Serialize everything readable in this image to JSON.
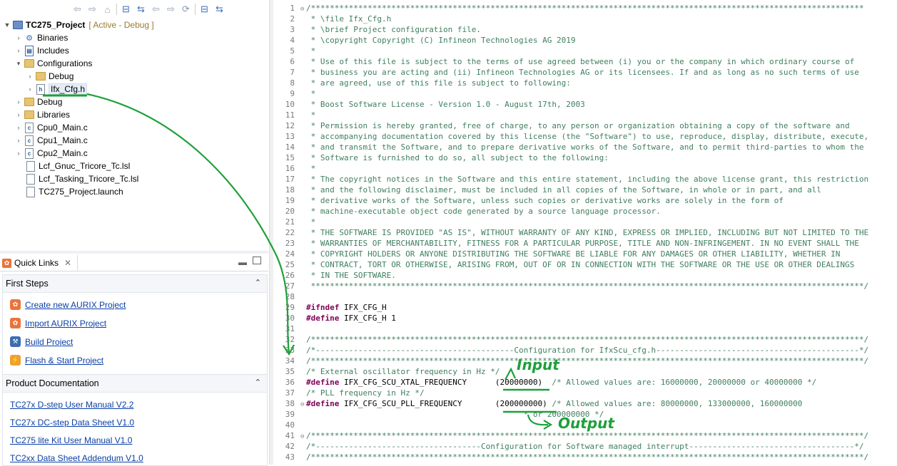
{
  "explorer": {
    "toolbar_icons": [
      "back-icon",
      "forward-icon",
      "home-icon",
      "collapse-all-icon",
      "link-editor-icon",
      "nav-back-icon",
      "nav-forward-icon",
      "sync-icon",
      "collapse-icon",
      "link-icon"
    ],
    "project_name": "TC275_Project",
    "project_status": "[ Active - Debug ]",
    "items": [
      {
        "label": "Binaries",
        "type": "binaries",
        "level": 1,
        "expanded": false
      },
      {
        "label": "Includes",
        "type": "includes",
        "level": 1,
        "expanded": false
      },
      {
        "label": "Configurations",
        "type": "folder",
        "level": 1,
        "expanded": true
      },
      {
        "label": "Debug",
        "type": "folder",
        "level": 2,
        "expanded": false
      },
      {
        "label": "Ifx_Cfg.h",
        "type": "header",
        "level": 2,
        "expanded": false,
        "selected": true
      },
      {
        "label": "Debug",
        "type": "folder",
        "level": 1,
        "expanded": false
      },
      {
        "label": "Libraries",
        "type": "folder",
        "level": 1,
        "expanded": false
      },
      {
        "label": "Cpu0_Main.c",
        "type": "c-file",
        "level": 1,
        "expanded": false
      },
      {
        "label": "Cpu1_Main.c",
        "type": "c-file",
        "level": 1,
        "expanded": false
      },
      {
        "label": "Cpu2_Main.c",
        "type": "c-file",
        "level": 1,
        "expanded": false
      },
      {
        "label": "Lcf_Gnuc_Tricore_Tc.lsl",
        "type": "file",
        "level": 1,
        "leaf": true
      },
      {
        "label": "Lcf_Tasking_Tricore_Tc.lsl",
        "type": "file",
        "level": 1,
        "leaf": true
      },
      {
        "label": "TC275_Project.launch",
        "type": "file",
        "level": 1,
        "leaf": true
      }
    ]
  },
  "quick_links": {
    "tab_title": "Quick Links",
    "first_steps_title": "First Steps",
    "first_steps": [
      {
        "label": "Create new AURIX Project",
        "color": "#e9743b",
        "icon": "new-project-icon"
      },
      {
        "label": "Import AURIX Project",
        "color": "#e9743b",
        "icon": "import-project-icon"
      },
      {
        "label": "Build Project",
        "color": "#3a6db3",
        "icon": "hammer-icon"
      },
      {
        "label": "Flash & Start Project",
        "color": "#f0a030",
        "icon": "flash-icon"
      }
    ],
    "product_doc_title": "Product Documentation",
    "docs": [
      "TC27x D-step User Manual V2.2",
      "TC27x DC-step Data Sheet V1.0",
      "TC275 lite Kit User Manual V1.0",
      "TC2xx Data Sheet Addendum V1.0"
    ]
  },
  "editor": {
    "lines": [
      {
        "n": "1",
        "t": "/*********************************************************************************************************************",
        "k": "comment",
        "fold": "-"
      },
      {
        "n": "2",
        "t": " * \\file Ifx_Cfg.h",
        "k": "comment"
      },
      {
        "n": "3",
        "t": " * \\brief Project configuration file.",
        "k": "comment"
      },
      {
        "n": "4",
        "t": " * \\copyright Copyright (C) Infineon Technologies AG 2019",
        "k": "comment"
      },
      {
        "n": "5",
        "t": " *",
        "k": "comment"
      },
      {
        "n": "6",
        "t": " * Use of this file is subject to the terms of use agreed between (i) you or the company in which ordinary course of",
        "k": "comment"
      },
      {
        "n": "7",
        "t": " * business you are acting and (ii) Infineon Technologies AG or its licensees. If and as long as no such terms of use",
        "k": "comment"
      },
      {
        "n": "8",
        "t": " * are agreed, use of this file is subject to following:",
        "k": "comment"
      },
      {
        "n": "9",
        "t": " *",
        "k": "comment"
      },
      {
        "n": "10",
        "t": " * Boost Software License - Version 1.0 - August 17th, 2003",
        "k": "comment"
      },
      {
        "n": "11",
        "t": " *",
        "k": "comment"
      },
      {
        "n": "12",
        "t": " * Permission is hereby granted, free of charge, to any person or organization obtaining a copy of the software and",
        "k": "comment"
      },
      {
        "n": "13",
        "t": " * accompanying documentation covered by this license (the \"Software\") to use, reproduce, display, distribute, execute,",
        "k": "comment"
      },
      {
        "n": "14",
        "t": " * and transmit the Software, and to prepare derivative works of the Software, and to permit third-parties to whom the",
        "k": "comment"
      },
      {
        "n": "15",
        "t": " * Software is furnished to do so, all subject to the following:",
        "k": "comment"
      },
      {
        "n": "16",
        "t": " *",
        "k": "comment"
      },
      {
        "n": "17",
        "t": " * The copyright notices in the Software and this entire statement, including the above license grant, this restriction",
        "k": "comment"
      },
      {
        "n": "18",
        "t": " * and the following disclaimer, must be included in all copies of the Software, in whole or in part, and all",
        "k": "comment"
      },
      {
        "n": "19",
        "t": " * derivative works of the Software, unless such copies or derivative works are solely in the form of",
        "k": "comment"
      },
      {
        "n": "20",
        "t": " * machine-executable object code generated by a source language processor.",
        "k": "comment"
      },
      {
        "n": "21",
        "t": " *",
        "k": "comment"
      },
      {
        "n": "22",
        "t": " * THE SOFTWARE IS PROVIDED \"AS IS\", WITHOUT WARRANTY OF ANY KIND, EXPRESS OR IMPLIED, INCLUDING BUT NOT LIMITED TO THE",
        "k": "comment"
      },
      {
        "n": "23",
        "t": " * WARRANTIES OF MERCHANTABILITY, FITNESS FOR A PARTICULAR PURPOSE, TITLE AND NON-INFRINGEMENT. IN NO EVENT SHALL THE",
        "k": "comment"
      },
      {
        "n": "24",
        "t": " * COPYRIGHT HOLDERS OR ANYONE DISTRIBUTING THE SOFTWARE BE LIABLE FOR ANY DAMAGES OR OTHER LIABILITY, WHETHER IN",
        "k": "comment"
      },
      {
        "n": "25",
        "t": " * CONTRACT, TORT OR OTHERWISE, ARISING FROM, OUT OF OR IN CONNECTION WITH THE SOFTWARE OR THE USE OR OTHER DEALINGS",
        "k": "comment"
      },
      {
        "n": "26",
        "t": " * IN THE SOFTWARE.",
        "k": "comment"
      },
      {
        "n": "27",
        "t": " *********************************************************************************************************************/",
        "k": "comment"
      },
      {
        "n": "28",
        "t": "",
        "k": "comment"
      },
      {
        "n": "29",
        "t": "#ifndef IFX_CFG_H",
        "k": "pp"
      },
      {
        "n": "30",
        "t": "#define IFX_CFG_H 1",
        "k": "pp"
      },
      {
        "n": "31",
        "t": "",
        "k": "comment"
      },
      {
        "n": "32",
        "t": "/*********************************************************************************************************************/",
        "k": "comment"
      },
      {
        "n": "33",
        "t": "/*------------------------------------------Configuration for IfxScu_cfg.h-------------------------------------------*/",
        "k": "comment"
      },
      {
        "n": "34",
        "t": "/*********************************************************************************************************************/",
        "k": "comment"
      },
      {
        "n": "35",
        "t": "/* External oscillator frequency in Hz */",
        "k": "comment"
      },
      {
        "n": "36",
        "t": "#define IFX_CFG_SCU_XTAL_FREQUENCY      (20000000)  /* Allowed values are: 16000000, 20000000 or 40000000 */",
        "k": "define"
      },
      {
        "n": "37",
        "t": "/* PLL frequency in Hz */",
        "k": "comment"
      },
      {
        "n": "38",
        "t": "#define IFX_CFG_SCU_PLL_FREQUENCY       (200000000) /* Allowed values are: 80000000, 133000000, 160000000",
        "k": "define",
        "fold": "-"
      },
      {
        "n": "39",
        "t": "                                              * or 200000000 */",
        "k": "comment"
      },
      {
        "n": "40",
        "t": "",
        "k": "comment"
      },
      {
        "n": "41",
        "t": "/*********************************************************************************************************************/",
        "k": "comment",
        "fold": "-"
      },
      {
        "n": "42",
        "t": "/*-----------------------------------Configuration for Software managed interrupt-----------------------------------*/",
        "k": "comment"
      },
      {
        "n": "43",
        "t": "/*********************************************************************************************************************/",
        "k": "comment"
      }
    ]
  },
  "annotations": {
    "input_label": "Input",
    "output_label": "Output",
    "color": "#1ea03a"
  }
}
